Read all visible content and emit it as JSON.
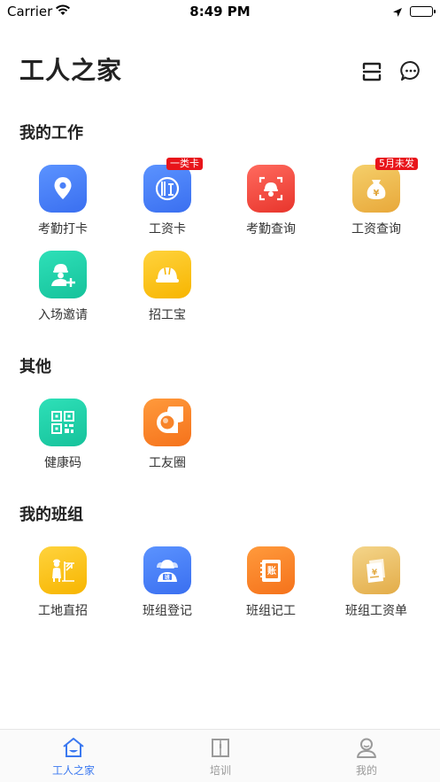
{
  "status": {
    "carrier": "Carrier",
    "time": "8:49 PM"
  },
  "header": {
    "title": "工人之家",
    "scan_icon": "scan-icon",
    "message_icon": "chat-bubble-icon"
  },
  "sections": {
    "work": {
      "title": "我的工作",
      "items": [
        {
          "label": "考勤打卡",
          "icon": "location-pin-icon",
          "color": "#4a80f8"
        },
        {
          "label": "工资卡",
          "icon": "bank-card-icon",
          "color": "#4a80f8",
          "badge": "一类卡"
        },
        {
          "label": "考勤查询",
          "icon": "helmet-scan-icon",
          "color": "#f0443a"
        },
        {
          "label": "工资查询",
          "icon": "money-bag-icon",
          "color": "#eebd55",
          "badge": "5月未发"
        },
        {
          "label": "入场邀请",
          "icon": "worker-add-icon",
          "color": "#1fd1a9"
        },
        {
          "label": "招工宝",
          "icon": "hard-hat-icon",
          "color": "#fbc21b"
        }
      ]
    },
    "other": {
      "title": "其他",
      "items": [
        {
          "label": "健康码",
          "icon": "qr-code-icon",
          "color": "#1fd1a9"
        },
        {
          "label": "工友圈",
          "icon": "chat-circle-icon",
          "color": "#f8842a"
        }
      ]
    },
    "team": {
      "title": "我的班组",
      "items": [
        {
          "label": "工地直招",
          "icon": "construction-worker-icon",
          "color": "#fbc21b"
        },
        {
          "label": "班组登记",
          "icon": "team-helmet-icon",
          "color": "#4a80f8"
        },
        {
          "label": "班组记工",
          "icon": "ledger-icon",
          "color": "#f8842a"
        },
        {
          "label": "班组工资单",
          "icon": "payslip-icon",
          "color": "#ecc26a"
        }
      ]
    }
  },
  "tabbar": {
    "items": [
      {
        "label": "工人之家",
        "icon": "home-icon",
        "active": true
      },
      {
        "label": "培训",
        "icon": "book-icon",
        "active": false
      },
      {
        "label": "我的",
        "icon": "user-icon",
        "active": false
      }
    ]
  }
}
